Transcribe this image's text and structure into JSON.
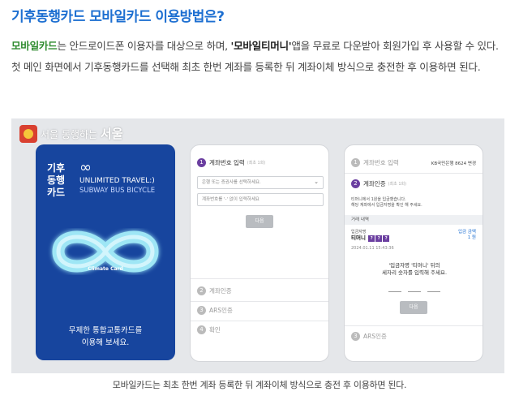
{
  "headline": "기후동행카드 모바일카드 이용방법은?",
  "body": {
    "kw_mobile": "모바일카드",
    "text1": "는 안드로이드폰 이용자를 대상으로 하며, ",
    "kw_app": "'모바일티머니'",
    "text2": "앱을 무료로 다운받아 회원가입 후 사용할 수 있다. 첫 메인 화면에서 기후동행카드를 선택해 최초 한번 계좌를 등록한 뒤 계좌이체 방식으로 충전한 후 이용하면 된다."
  },
  "figure": {
    "slogan_prefix": "서울 동행하는",
    "slogan_big": "서울",
    "card": {
      "name": "기후 동행 카드",
      "infinity_glyph": "∞",
      "title": "UNLIMITED TRAVEL:)",
      "subtitle": "SUBWAY BUS BICYCLE",
      "brand": "Climate Card",
      "message_line1": "무제한 통합교통카드를",
      "message_line2": "이용해 보세요."
    },
    "phone1": {
      "step1_num": "1",
      "step1_label": "계좌번호 입력",
      "step1_sub": "(최초 1회)",
      "select_placeholder": "은행 또는 증권사를 선택하세요.",
      "account_placeholder": "계좌번호를 '-' 없이 입력하세요",
      "next_label": "다음",
      "step2_num": "2",
      "step2_label": "계좌인증",
      "step3_num": "3",
      "step3_label": "ARS인증",
      "step4_num": "4",
      "step4_label": "확인"
    },
    "phone2": {
      "step1_num": "1",
      "step1_label": "계좌번호 입력",
      "bank_info": "KB국민은행 8624 변경",
      "step2_num": "2",
      "step2_label": "계좌인증",
      "step2_sub": "(최초 1회)",
      "notice_line1": "티머니에서 1원을 입금했습니다.",
      "notice_line2": "해당 계좌에서 입금자명을 확인 해 주세요.",
      "history_header": "거래 내역",
      "depositor_label": "입금자명",
      "depositor_name": "티머니",
      "depositor_codes": [
        "?",
        "?",
        "?"
      ],
      "amount_label": "입금 금액",
      "amount_value": "1 원",
      "timestamp": "2024.01.11 15:43:36",
      "prompt_line1": "'입금자명 '티머니' 뒤의",
      "prompt_line2": "세자리 숫자를 입력해 주세요.",
      "next_label": "다음",
      "step3_num": "3",
      "step3_label": "ARS인증"
    }
  },
  "caption": "모바일카드는 최초 한번 계좌 등록한 뒤 계좌이체 방식으로 충전 후 이용하면 된다.",
  "colors": {
    "headline": "#1d6fd1",
    "keyword_green": "#2e8b2e",
    "card_blue": "#17459e",
    "step_purple": "#6b3fa0"
  }
}
